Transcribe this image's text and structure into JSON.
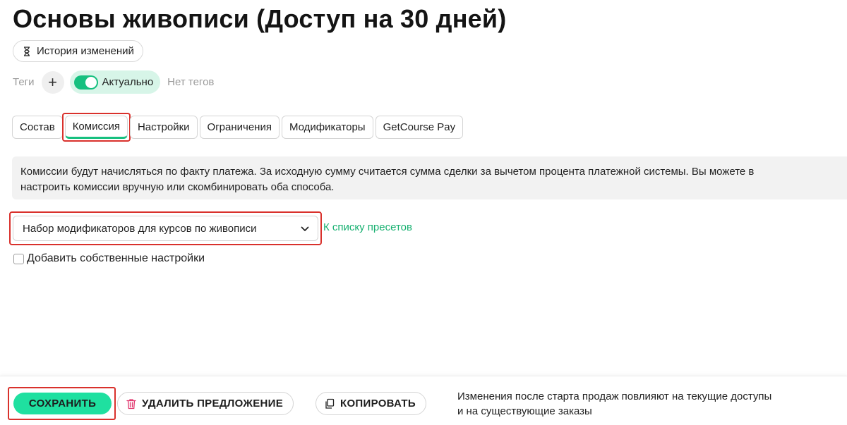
{
  "page": {
    "title": "Основы живописи (Доступ на 30 дней)"
  },
  "history": {
    "label": "История изменений",
    "icon": "hourglass-icon"
  },
  "tags": {
    "label": "Теги",
    "add": "+",
    "status_toggle_label": "Актуально",
    "status_toggle_on": true,
    "empty_text": "Нет тегов",
    "accent_color": "#16c07f"
  },
  "tabs": [
    {
      "label": "Состав",
      "active": false
    },
    {
      "label": "Комиссия",
      "active": true
    },
    {
      "label": "Настройки",
      "active": false
    },
    {
      "label": "Ограничения",
      "active": false
    },
    {
      "label": "Модификаторы",
      "active": false
    },
    {
      "label": "GetCourse Pay",
      "active": false
    }
  ],
  "info": {
    "line1": "Комиссии будут начисляться по факту платежа. За исходную сумму считается сумма сделки за вычетом процента платежной системы. Вы можете в",
    "line2": "настроить комиссии вручную или скомбинировать оба способа."
  },
  "preset": {
    "selected": "Набор модификаторов для курсов по живописи",
    "link": "К списку пресетов"
  },
  "own_settings": {
    "label": "Добавить собственные настройки",
    "checked": false
  },
  "footer": {
    "save": "СОХРАНИТЬ",
    "delete": "УДАЛИТЬ ПРЕДЛОЖЕНИЕ",
    "copy": "КОПИРОВАТЬ",
    "note_line1": "Изменения после старта продаж повлияют на текущие доступы",
    "note_line2": "и на существующие заказы",
    "save_color": "#1fe0a0",
    "highlight_color": "#d9312c"
  }
}
